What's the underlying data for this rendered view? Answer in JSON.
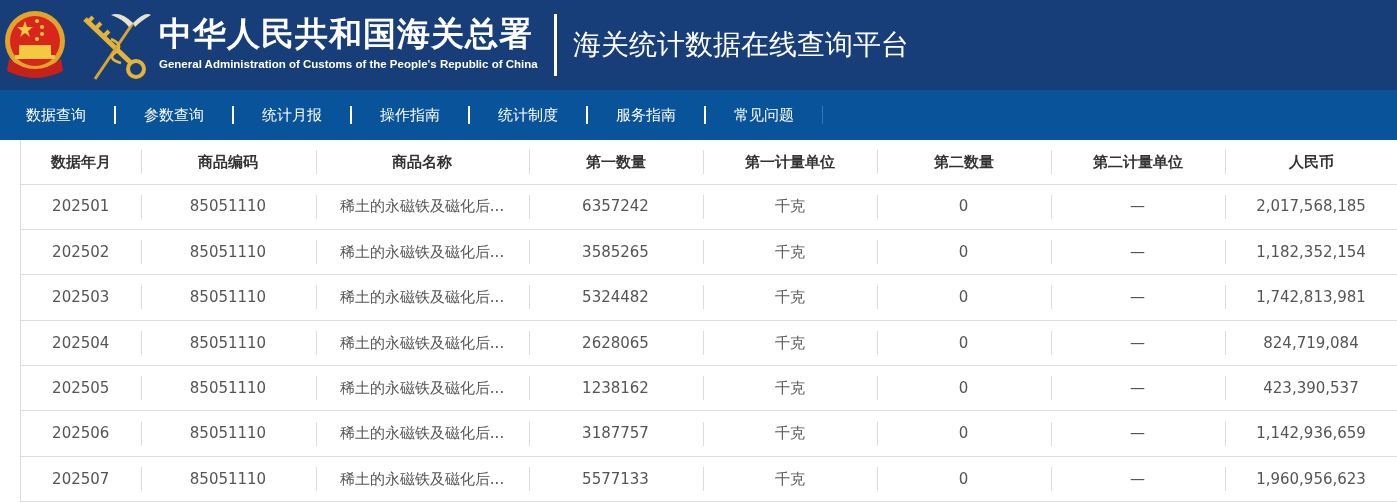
{
  "header": {
    "title": "中华人民共和国海关总署",
    "subtitle": "General Administration of Customs of the People's Republic of China",
    "platform": "海关统计数据在线查询平台"
  },
  "nav": [
    {
      "label": "数据查询"
    },
    {
      "label": "参数查询"
    },
    {
      "label": "统计月报"
    },
    {
      "label": "操作指南"
    },
    {
      "label": "统计制度"
    },
    {
      "label": "服务指南"
    },
    {
      "label": "常见问题"
    }
  ],
  "table": {
    "columns": [
      "数据年月",
      "商品编码",
      "商品名称",
      "第一数量",
      "第一计量单位",
      "第二数量",
      "第二计量单位",
      "人民币"
    ],
    "rows": [
      [
        "202501",
        "85051110",
        "稀土的永磁铁及磁化后...",
        "6357242",
        "千克",
        "0",
        "—",
        "2,017,568,185"
      ],
      [
        "202502",
        "85051110",
        "稀土的永磁铁及磁化后...",
        "3585265",
        "千克",
        "0",
        "—",
        "1,182,352,154"
      ],
      [
        "202503",
        "85051110",
        "稀土的永磁铁及磁化后...",
        "5324482",
        "千克",
        "0",
        "—",
        "1,742,813,981"
      ],
      [
        "202504",
        "85051110",
        "稀土的永磁铁及磁化后...",
        "2628065",
        "千克",
        "0",
        "—",
        "824,719,084"
      ],
      [
        "202505",
        "85051110",
        "稀土的永磁铁及磁化后...",
        "1238162",
        "千克",
        "0",
        "—",
        "423,390,537"
      ],
      [
        "202506",
        "85051110",
        "稀土的永磁铁及磁化后...",
        "3187757",
        "千克",
        "0",
        "—",
        "1,142,936,659"
      ],
      [
        "202507",
        "85051110",
        "稀土的永磁铁及磁化后...",
        "5577133",
        "千克",
        "0",
        "—",
        "1,960,956,623"
      ]
    ]
  }
}
